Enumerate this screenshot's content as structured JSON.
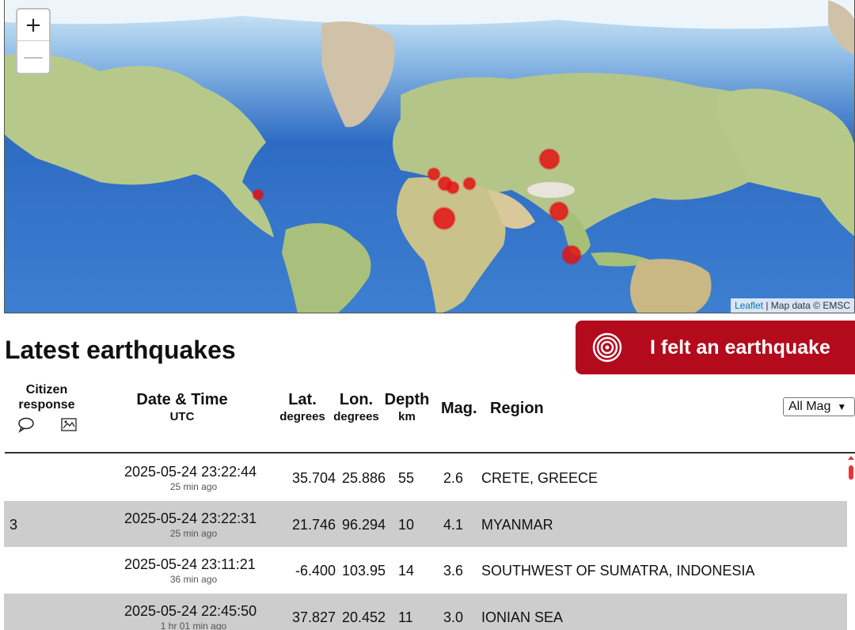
{
  "map": {
    "zoom_in": "+",
    "zoom_out": "—",
    "attribution_link": "Leaflet",
    "attribution_text": "| Map data © EMSC"
  },
  "page_title": "Latest earthquakes",
  "felt_button": "I felt an earthquake",
  "table_header": {
    "citizen": "Citizen",
    "response": "response",
    "date_time": "Date & Time",
    "utc": "UTC",
    "lat": "Lat.",
    "lon": "Lon.",
    "degrees": "degrees",
    "depth": "Depth",
    "km": "km",
    "mag": "Mag.",
    "region": "Region",
    "mag_filter": "All Mag"
  },
  "quakes": [
    {
      "citizen": "",
      "datetime": "2025-05-24 23:22:44",
      "ago": "25 min ago",
      "lat": "35.704",
      "lon": "25.886",
      "depth": "55",
      "mag": "2.6",
      "region": "CRETE, GREECE"
    },
    {
      "citizen": "3",
      "datetime": "2025-05-24 23:22:31",
      "ago": "25 min ago",
      "lat": "21.746",
      "lon": "96.294",
      "depth": "10",
      "mag": "4.1",
      "region": "MYANMAR"
    },
    {
      "citizen": "",
      "datetime": "2025-05-24 23:11:21",
      "ago": "36 min ago",
      "lat": "-6.400",
      "lon": "103.95",
      "depth": "14",
      "mag": "3.6",
      "region": "SOUTHWEST OF SUMATRA, INDONESIA"
    },
    {
      "citizen": "",
      "datetime": "2025-05-24 22:45:50",
      "ago": "1 hr 01 min ago",
      "lat": "37.827",
      "lon": "20.452",
      "depth": "11",
      "mag": "3.0",
      "region": "IONIAN SEA"
    }
  ],
  "colors": {
    "ocean": "#2f6fc8",
    "land": "#b7c98a",
    "felt_button": "#b30a1c",
    "quake_marker": "#e31212",
    "alt_row": "#cdcdcd"
  }
}
